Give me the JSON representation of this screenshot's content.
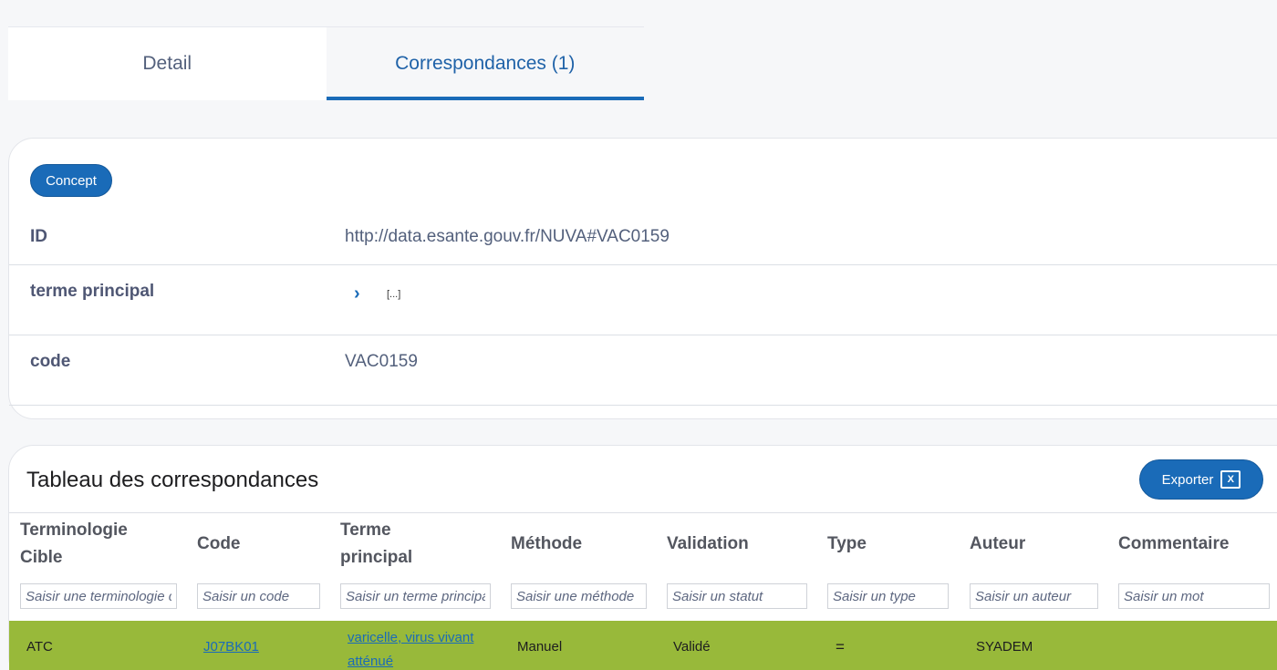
{
  "tabs": [
    {
      "label": "Detail"
    },
    {
      "label": "Correspondances (1)"
    }
  ],
  "concept": {
    "chip": "Concept",
    "rows": [
      {
        "label": "ID",
        "value": "http://data.esante.gouv.fr/NUVA#VAC0159"
      },
      {
        "label": "terme principal",
        "value": "[...]"
      },
      {
        "label": "code",
        "value": "VAC0159"
      }
    ]
  },
  "table": {
    "title": "Tableau des correspondances",
    "export_label": "Exporter",
    "export_icon": "excel-icon",
    "columns": [
      {
        "header_line1": "Terminologie",
        "header_line2": "Cible",
        "placeholder": "Saisir une terminologie cible"
      },
      {
        "header_line1": "Code",
        "header_line2": "",
        "placeholder": "Saisir un code"
      },
      {
        "header_line1": "Terme",
        "header_line2": "principal",
        "placeholder": "Saisir un terme principal"
      },
      {
        "header_line1": "Méthode",
        "header_line2": "",
        "placeholder": "Saisir une méthode"
      },
      {
        "header_line1": "Validation",
        "header_line2": "",
        "placeholder": "Saisir un statut"
      },
      {
        "header_line1": "Type",
        "header_line2": "",
        "placeholder": "Saisir un type"
      },
      {
        "header_line1": "Auteur",
        "header_line2": "",
        "placeholder": "Saisir un auteur"
      },
      {
        "header_line1": "Commentaire",
        "header_line2": "",
        "placeholder": "Saisir un mot"
      }
    ],
    "rows": [
      {
        "terminologie": "ATC",
        "code": "J07BK01",
        "terme_line1": "varicelle, virus vivant",
        "terme_line2": "atténué",
        "methode": "Manuel",
        "validation": "Validé",
        "type": "=",
        "auteur": "SYADEM",
        "commentaire": ""
      }
    ],
    "row_color": "#98b93a"
  },
  "colors": {
    "accent": "#1a6bb8",
    "background": "#f6f7f9"
  }
}
